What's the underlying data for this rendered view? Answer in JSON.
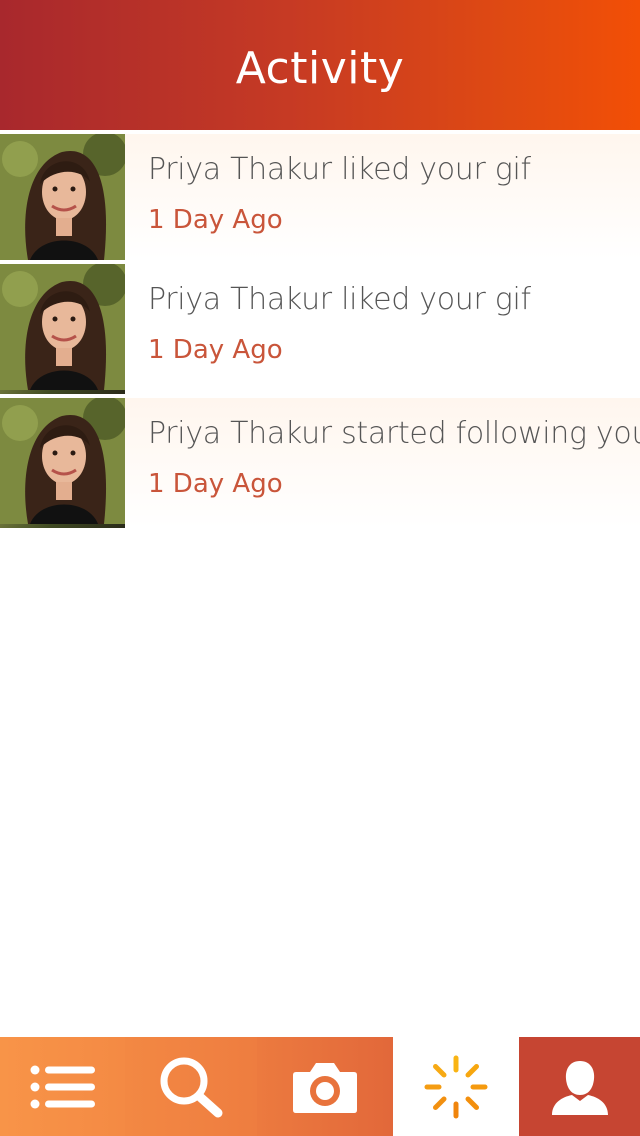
{
  "header": {
    "title": "Activity"
  },
  "activity": [
    {
      "name": "Priya Thakur",
      "message": "Priya Thakur liked your gif",
      "time": "1 Day Ago"
    },
    {
      "name": "Priya Thakur",
      "message": "Priya Thakur liked your gif",
      "time": "1 Day Ago"
    },
    {
      "name": "Priya Thakur",
      "message": "Priya Thakur started following you",
      "time": "1 Day Ago"
    }
  ],
  "tabs": [
    {
      "id": "feed",
      "icon": "list-icon"
    },
    {
      "id": "search",
      "icon": "search-icon"
    },
    {
      "id": "camera",
      "icon": "camera-icon"
    },
    {
      "id": "activity",
      "icon": "activity-spinner-icon",
      "active": true
    },
    {
      "id": "profile",
      "icon": "profile-icon"
    }
  ],
  "colors": {
    "header_start": "#a8282d",
    "header_end": "#f24f06",
    "timestamp": "#c9553a",
    "tab_orange": "#f48a44",
    "tab_active_icon": "#f5a00c",
    "tab_profile": "#c64532"
  }
}
